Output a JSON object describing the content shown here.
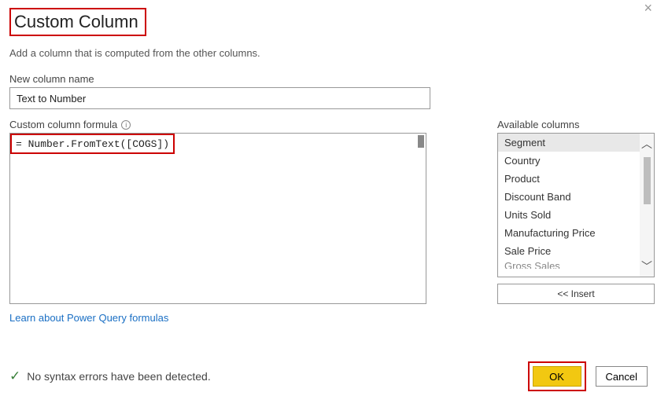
{
  "dialog": {
    "title": "Custom Column",
    "subtitle": "Add a column that is computed from the other columns."
  },
  "fields": {
    "column_name_label": "New column name",
    "column_name_value": "Text to Number",
    "formula_label": "Custom column formula",
    "formula_value": "= Number.FromText([COGS])"
  },
  "available": {
    "label": "Available columns",
    "items": [
      "Segment",
      "Country",
      "Product",
      "Discount Band",
      "Units Sold",
      "Manufacturing Price",
      "Sale Price",
      "Gross Sales"
    ],
    "insert_label": "<< Insert"
  },
  "link": {
    "learn_more": "Learn about Power Query formulas"
  },
  "status": {
    "message": "No syntax errors have been detected."
  },
  "buttons": {
    "ok": "OK",
    "cancel": "Cancel"
  }
}
